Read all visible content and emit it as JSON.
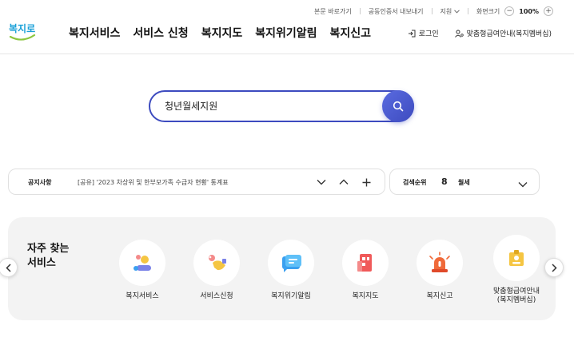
{
  "utility": {
    "skip_link": "본문 바로가기",
    "cert_export": "공동인증서 내보내기",
    "region": "지원",
    "zoom_label": "화면크기",
    "zoom_minus": "−",
    "zoom_value": "100%",
    "zoom_plus": "+"
  },
  "logo": {
    "text": "복지로"
  },
  "nav": {
    "items": [
      "복지서비스",
      "서비스 신청",
      "복지지도",
      "복지위기알림",
      "복지신고"
    ]
  },
  "header_right": {
    "login": "로그인",
    "custom_benefit": "맞춤형급여안내(복지멤버십)"
  },
  "search": {
    "value": "청년월세지원"
  },
  "notice": {
    "label": "공지사항",
    "text": "[공유] '2023 차상위 및 한부모가족 수급자 현황' 통계표"
  },
  "ranking": {
    "label": "검색순위",
    "rank": "8",
    "keyword": "월세"
  },
  "quick": {
    "title_line1": "자주 찾는",
    "title_line2": "서비스",
    "items": [
      {
        "label": "복지서비스",
        "icon": "people-icon",
        "color": "#f5c542"
      },
      {
        "label": "서비스신청",
        "icon": "hand-apply-icon",
        "color": "#f48a8a"
      },
      {
        "label": "복지위기알림",
        "icon": "chat-alert-icon",
        "color": "#3aa0f0"
      },
      {
        "label": "복지지도",
        "icon": "map-building-icon",
        "color": "#f05a5a"
      },
      {
        "label": "복지신고",
        "icon": "siren-icon",
        "color": "#f06a3a"
      },
      {
        "label": "맞춤형급여안내(복지멤버십)",
        "label_line1": "맞춤형급여안내",
        "label_line2": "(복지멤버십)",
        "icon": "id-card-icon",
        "color": "#f5c542"
      }
    ]
  },
  "colors": {
    "primary": "#3d4bbf",
    "logo_blue": "#1aa0d8",
    "logo_green": "#8cc63f"
  }
}
